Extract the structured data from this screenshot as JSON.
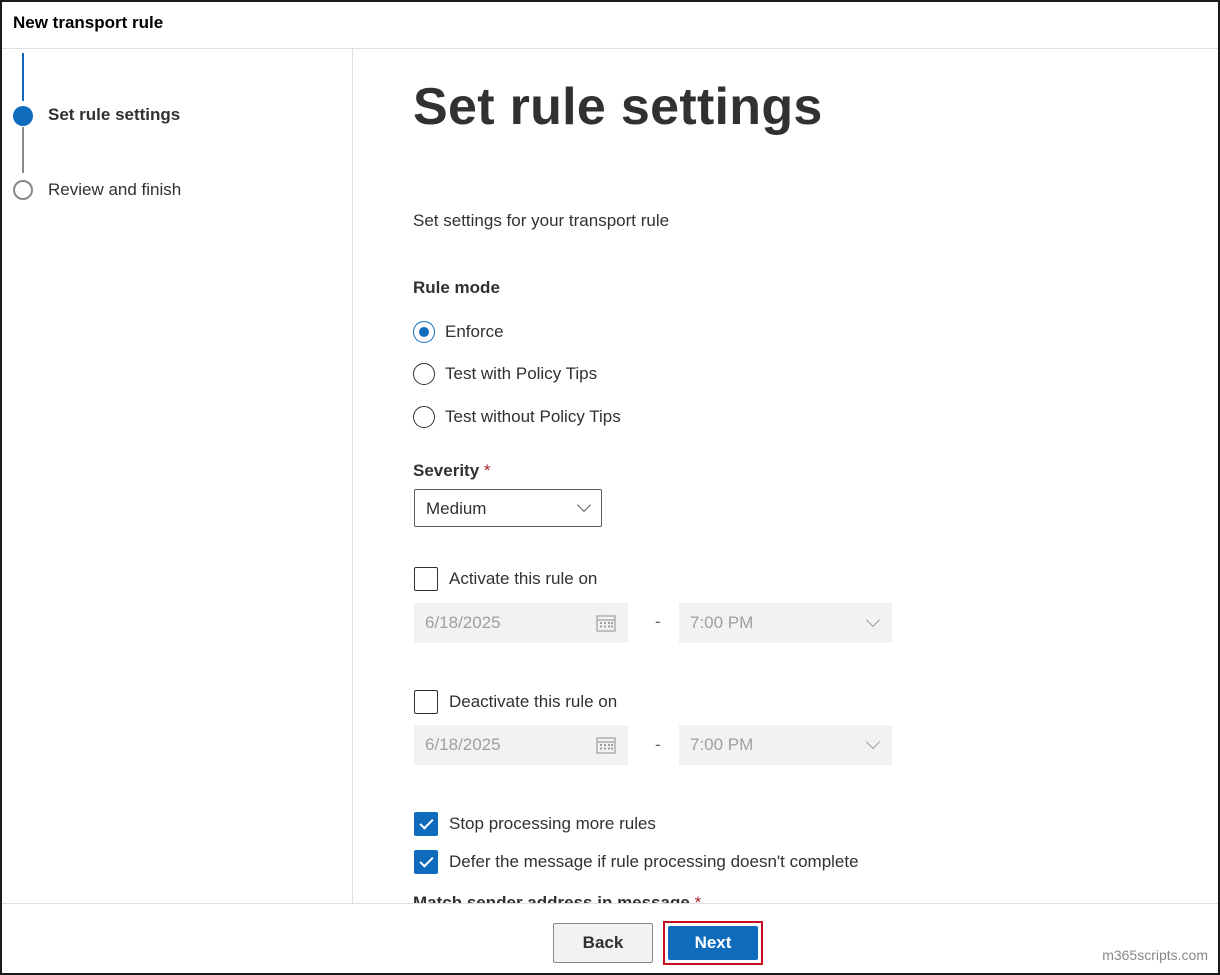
{
  "window": {
    "title": "New transport rule"
  },
  "steps": [
    {
      "label": "Set rule settings",
      "state": "current"
    },
    {
      "label": "Review and finish",
      "state": "upcoming"
    }
  ],
  "main": {
    "heading": "Set rule settings",
    "description": "Set settings for your transport rule",
    "rule_mode": {
      "label": "Rule mode",
      "options": [
        {
          "label": "Enforce",
          "selected": true
        },
        {
          "label": "Test with Policy Tips",
          "selected": false
        },
        {
          "label": "Test without Policy Tips",
          "selected": false
        }
      ]
    },
    "severity": {
      "label": "Severity",
      "required_mark": "*",
      "value": "Medium"
    },
    "activate": {
      "label": "Activate this rule on",
      "checked": false,
      "date": "6/18/2025",
      "separator": "-",
      "time": "7:00 PM"
    },
    "deactivate": {
      "label": "Deactivate this rule on",
      "checked": false,
      "date": "6/18/2025",
      "separator": "-",
      "time": "7:00 PM"
    },
    "stop_processing": {
      "label": "Stop processing more rules",
      "checked": true
    },
    "defer_message": {
      "label": "Defer the message if rule processing doesn't complete",
      "checked": true
    },
    "match_sender": {
      "label": "Match sender address in message",
      "required_mark": "*"
    }
  },
  "footer": {
    "back_label": "Back",
    "next_label": "Next"
  },
  "watermark": "m365scripts.com",
  "colors": {
    "accent": "#0f6cbd",
    "highlight_border": "#c50f1f",
    "required": "#a4262c"
  }
}
